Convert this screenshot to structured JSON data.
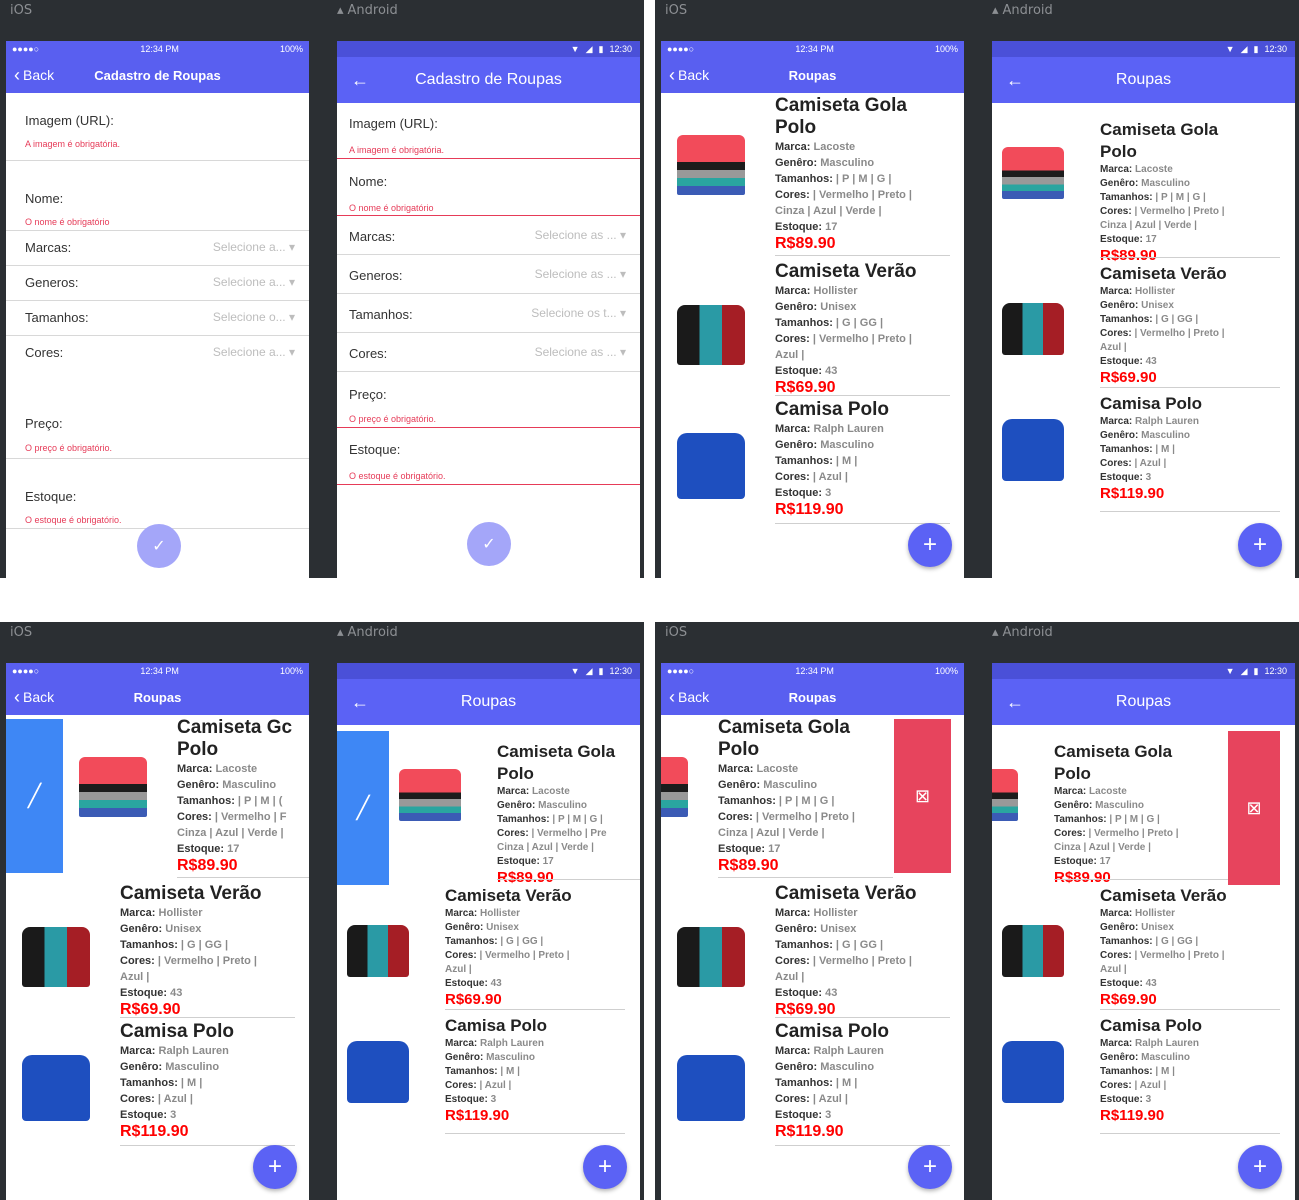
{
  "labels": {
    "ios": "iOS",
    "android": "Android"
  },
  "ios_status": {
    "time": "12:34 PM",
    "battery": "100%",
    "signal": "●●●●○"
  },
  "android_status": {
    "time": "12:30"
  },
  "back": "Back",
  "form": {
    "title": "Cadastro de Roupas",
    "image_label": "Imagem (URL):",
    "image_error": "A imagem é obrigatória.",
    "name_label": "Nome:",
    "name_error": "O nome é obrigatório",
    "brand_label": "Marcas:",
    "gender_label": "Generos:",
    "size_label": "Tamanhos:",
    "color_label": "Cores:",
    "price_label": "Preço:",
    "price_error_ios": "O preço é obrigatório.",
    "price_error_android": "O preço é obrigatório.",
    "stock_label": "Estoque:",
    "stock_error": "O estoque é obrigatório.",
    "ios_selects": [
      "Selecione a...",
      "Selecione a...",
      "Selecione o...",
      "Selecione a..."
    ],
    "android_selects": [
      "Selecione as ...",
      "Selecione as ...",
      "Selecione os t...",
      "Selecione as ..."
    ],
    "submit_icon": "check-icon"
  },
  "list": {
    "title": "Roupas",
    "fab_icon": "plus-icon",
    "edit_icon": "pencil-icon",
    "delete_icon": "trash-icon",
    "marca": "Marca:",
    "genero": "Genêro:",
    "tamanhos": "Tamanhos:",
    "cores": "Cores:",
    "estoque": "Estoque:",
    "items": [
      {
        "name1": "Camiseta Gola",
        "name2": "Polo",
        "name_trunc": "Camiseta Gc",
        "name_trunc_and": "Camiseta Gola",
        "marca": "Lacoste",
        "genero": "Masculino",
        "tamanhos": "| P | M | G |",
        "tamanhos_trunc": "| P | M | (",
        "cores1": "| Vermelho | Preto |",
        "cores1_trunc": "| Vermelho | F",
        "cores1_trunc_and": "| Vermelho | Pre",
        "cores2": "Cinza | Azul | Verde |",
        "estoque": "17",
        "price": "R$89.90"
      },
      {
        "name": "Camiseta Verão",
        "marca": "Hollister",
        "genero": "Unisex",
        "tamanhos": "| G | GG |",
        "cores1": "| Vermelho | Preto |",
        "cores2": "Azul |",
        "estoque": "43",
        "price": "R$69.90"
      },
      {
        "name": "Camisa Polo",
        "marca": "Ralph Lauren",
        "genero": "Masculino",
        "tamanhos": "| M |",
        "cores1": "| Azul |",
        "estoque": "3",
        "price": "R$119.90"
      }
    ]
  }
}
